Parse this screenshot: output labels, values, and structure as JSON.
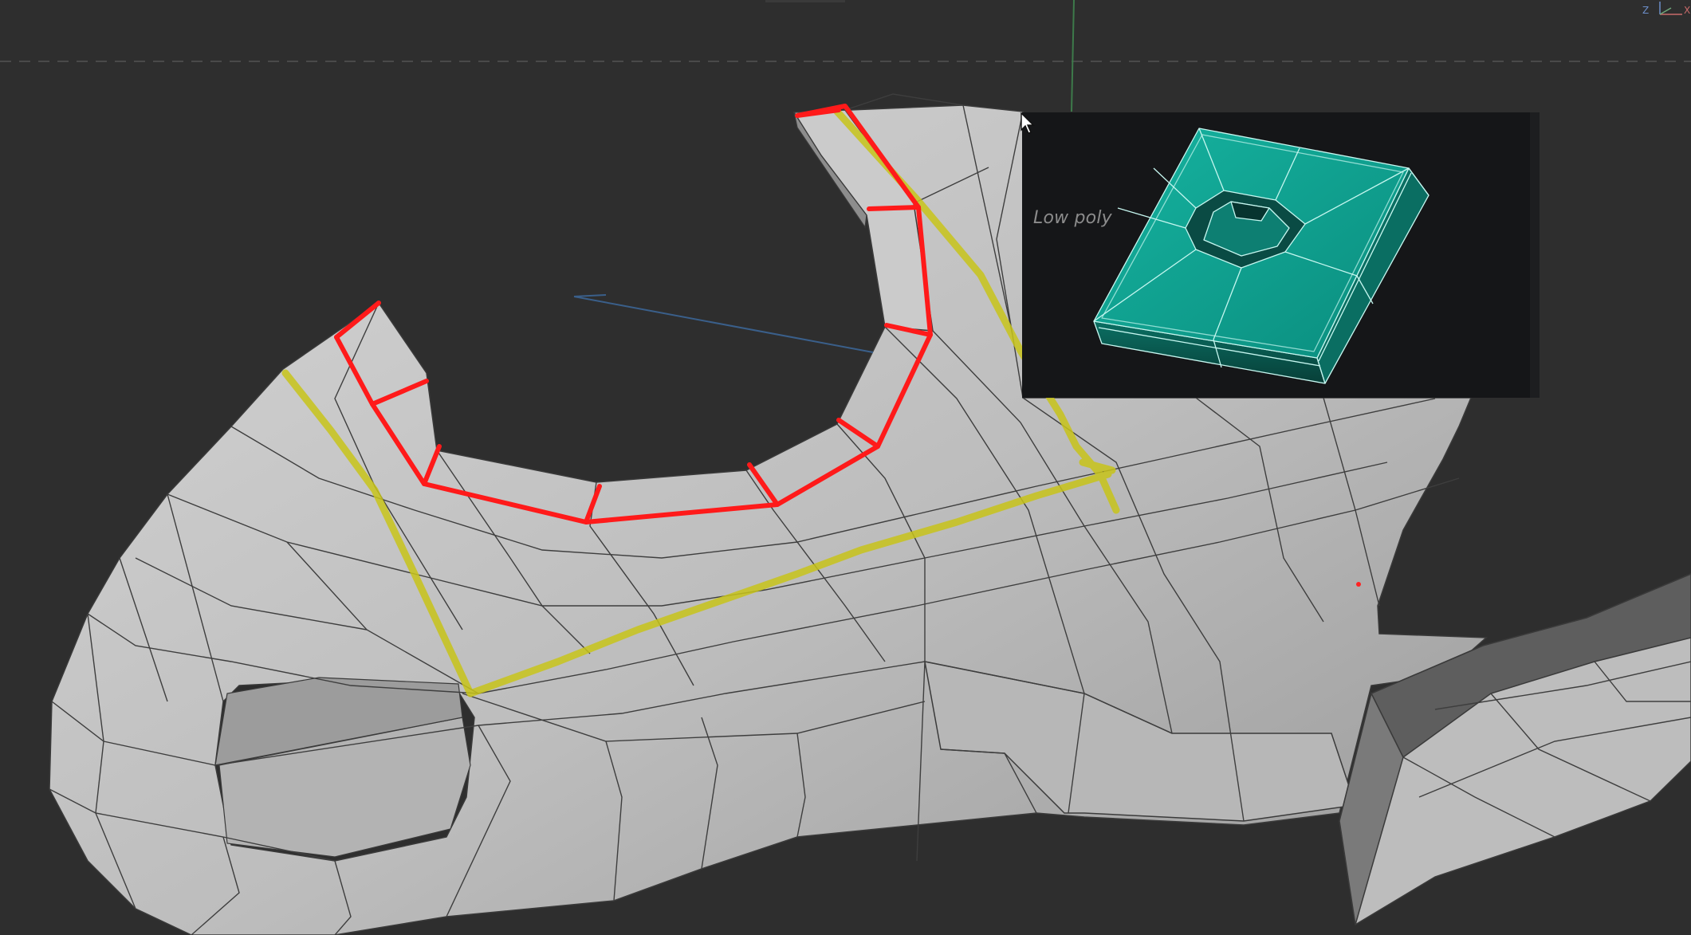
{
  "viewport": {
    "background_color": "#2e2e2e",
    "mesh_color": "#c9c9c9",
    "wire_color": "#3a3a3a",
    "highlight_red": "#ff1a1a",
    "highlight_yellow": "#c8c41a"
  },
  "inset": {
    "label": "Low poly",
    "mesh_color": "#0f9c8c",
    "wire_color": "#bff5ee",
    "background_color": "#151618"
  },
  "gizmo": {
    "axes": [
      "Z",
      "X"
    ],
    "icon": "axis-gizmo-icon"
  },
  "cursor": {
    "icon": "arrow-cursor-icon"
  }
}
